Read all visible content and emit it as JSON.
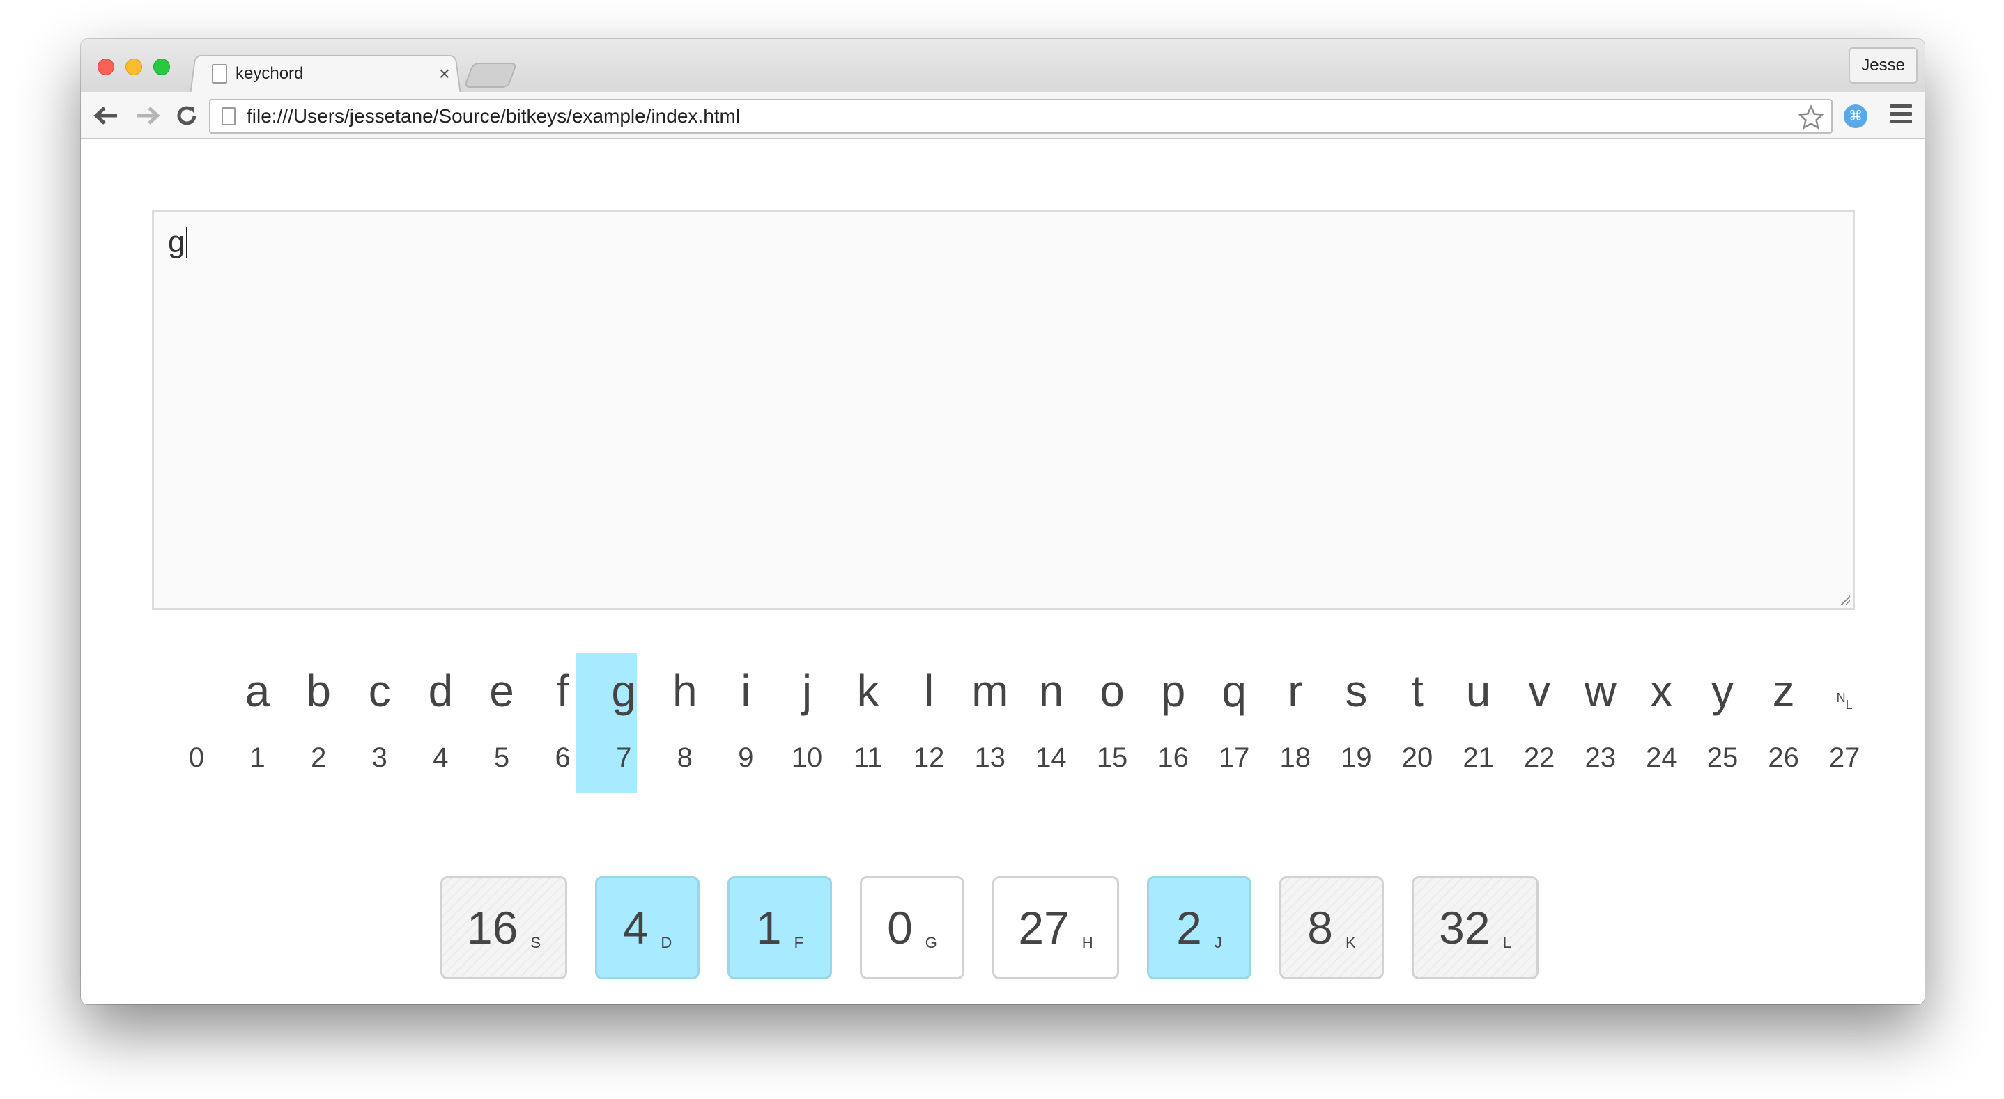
{
  "browser": {
    "tab_title": "keychord",
    "tab_close": "×",
    "profile_name": "Jesse",
    "url": "file:///Users/jessetane/Source/bitkeys/example/index.html"
  },
  "editor": {
    "text": "g"
  },
  "alphabet": {
    "letters": [
      "a",
      "b",
      "c",
      "d",
      "e",
      "f",
      "g",
      "h",
      "i",
      "j",
      "k",
      "l",
      "m",
      "n",
      "o",
      "p",
      "q",
      "r",
      "s",
      "t",
      "u",
      "v",
      "w",
      "x",
      "y",
      "z"
    ],
    "nl_top": "N",
    "nl_bottom": "L",
    "numbers": [
      "0",
      "1",
      "2",
      "3",
      "4",
      "5",
      "6",
      "7",
      "8",
      "9",
      "10",
      "11",
      "12",
      "13",
      "14",
      "15",
      "16",
      "17",
      "18",
      "19",
      "20",
      "21",
      "22",
      "23",
      "24",
      "25",
      "26",
      "27"
    ],
    "selected_index": 7
  },
  "keys": [
    {
      "value": "16",
      "letter": "S",
      "state": "hatched"
    },
    {
      "value": "4",
      "letter": "D",
      "state": "active"
    },
    {
      "value": "1",
      "letter": "F",
      "state": "active"
    },
    {
      "value": "0",
      "letter": "G",
      "state": "plain"
    },
    {
      "value": "27",
      "letter": "H",
      "state": "plain"
    },
    {
      "value": "2",
      "letter": "J",
      "state": "active"
    },
    {
      "value": "8",
      "letter": "K",
      "state": "hatched"
    },
    {
      "value": "32",
      "letter": "L",
      "state": "hatched"
    }
  ],
  "colors": {
    "highlight": "#a8eaff"
  }
}
